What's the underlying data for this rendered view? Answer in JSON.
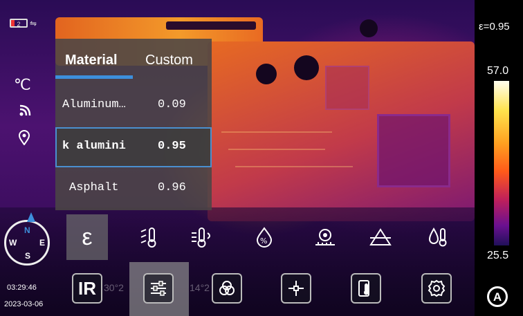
{
  "status": {
    "battery_level": "2",
    "charge_icon": "charging-icon",
    "unit": "℃",
    "icons": [
      "wifi-icon",
      "location-pin-icon"
    ]
  },
  "material_panel": {
    "tabs": [
      {
        "label": "Material",
        "active": true
      },
      {
        "label": "Custom",
        "active": false
      }
    ],
    "rows": [
      {
        "name": "Aluminum…",
        "value": "0.09",
        "selected": false
      },
      {
        "name": "k alumini",
        "value": "0.95",
        "selected": true
      },
      {
        "name": "Asphalt",
        "value": "0.96",
        "selected": false
      }
    ]
  },
  "compass": {
    "n": "N",
    "e": "E",
    "s": "S",
    "w": "W"
  },
  "clock": {
    "time": "03:29:46",
    "date": "2023-03-06"
  },
  "params": [
    {
      "name": "emissivity-icon",
      "glyph": "ε",
      "selected": true
    },
    {
      "name": "reflected-temp-icon",
      "glyph": "🌡"
    },
    {
      "name": "ambient-temp-icon",
      "glyph": "🌡"
    },
    {
      "name": "humidity-icon",
      "glyph": "💧"
    },
    {
      "name": "distance-icon",
      "glyph": "⌖"
    },
    {
      "name": "transmission-icon",
      "glyph": "△"
    },
    {
      "name": "compensation-icon",
      "glyph": "🌡"
    }
  ],
  "toolbar": {
    "ir_label": "IR",
    "bg_temps": [
      "30°2",
      "14°2"
    ],
    "tools": [
      "ir-mode-button",
      "adjust-button",
      "palette-button",
      "crosshair-button",
      "device-temp-button",
      "settings-button"
    ]
  },
  "scale": {
    "emissivity": "ε=0.95",
    "max": "57.0",
    "min": "25.5",
    "auto_label": "A"
  },
  "colors": {
    "accent": "#3d8fdc",
    "panel": "#4b4646"
  }
}
